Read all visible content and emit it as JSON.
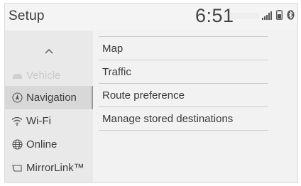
{
  "header": {
    "title": "Setup",
    "clock": "6:51"
  },
  "status_icons": [
    "signal-bars-icon",
    "phone-battery-icon",
    "bluetooth-icon"
  ],
  "sidebar": {
    "up_icon": "chevron-up-icon",
    "items": [
      {
        "label": "Vehicle",
        "icon": "car-icon",
        "state": "disabled"
      },
      {
        "label": "Navigation",
        "icon": "navigation-icon",
        "state": "selected"
      },
      {
        "label": "Wi-Fi",
        "icon": "wifi-icon",
        "state": "normal"
      },
      {
        "label": "Online",
        "icon": "globe-icon",
        "state": "normal"
      },
      {
        "label": "MirrorLink™",
        "icon": "mirrorlink-icon",
        "state": "normal"
      }
    ]
  },
  "main": {
    "items": [
      {
        "label": "Map"
      },
      {
        "label": "Traffic"
      },
      {
        "label": "Route preference"
      },
      {
        "label": "Manage stored destinations"
      }
    ]
  }
}
